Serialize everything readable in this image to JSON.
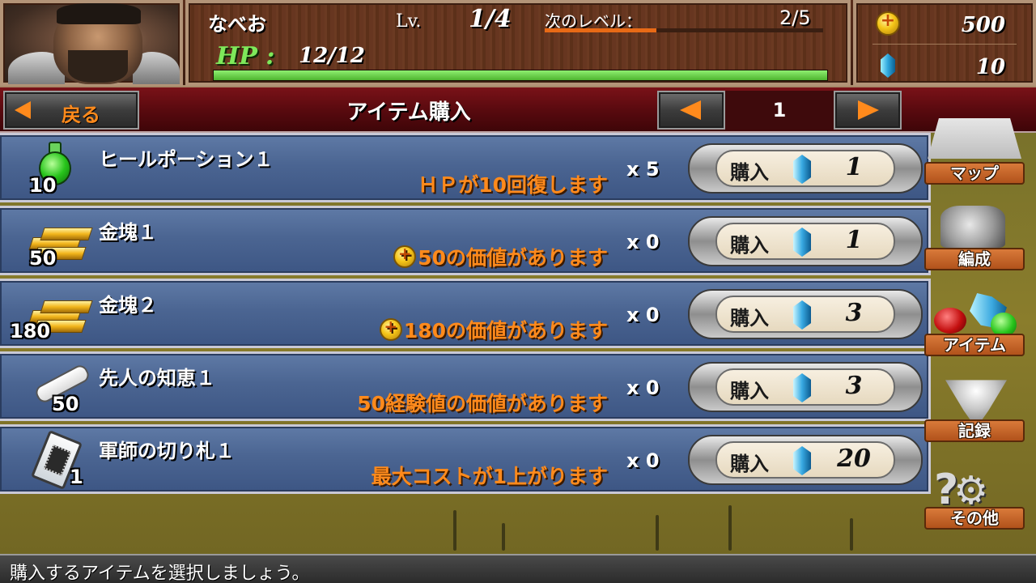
{
  "player": {
    "name": "なべお",
    "level_label": "Lv.",
    "level": "1/4",
    "next_level_label": "次のレベル：",
    "next_level_progress": "2/5",
    "next_level_fraction": 0.4,
    "hp_label": "HP :",
    "hp": "12/12",
    "hp_fraction": 1.0
  },
  "currency": {
    "gold": "500",
    "gems": "10"
  },
  "nav": {
    "back_label": "戻る",
    "title": "アイテム購入",
    "page": "1"
  },
  "buy_label": "購入",
  "items": [
    {
      "icon": "potion-icon",
      "count": "10",
      "name": "ヒールポーション１",
      "desc": "ＨＰが10回復します",
      "desc_coin": false,
      "qty": "x 5",
      "price": "1"
    },
    {
      "icon": "gold-bar-icon",
      "count": "50",
      "name": "金塊１",
      "desc": "50の価値があります",
      "desc_coin": true,
      "qty": "x 0",
      "price": "1"
    },
    {
      "icon": "gold-bar-icon",
      "count": "180",
      "name": "金塊２",
      "desc": "180の価値があります",
      "desc_coin": true,
      "qty": "x 0",
      "price": "3"
    },
    {
      "icon": "scroll-icon",
      "count": "50",
      "name": "先人の知恵１",
      "desc": "50経験値の価値があります",
      "desc_coin": false,
      "qty": "x 0",
      "price": "3"
    },
    {
      "icon": "card-icon",
      "count": "1",
      "name": "軍師の切り札１",
      "desc": "最大コストが1上がります",
      "desc_coin": false,
      "qty": "x 0",
      "price": "20"
    }
  ],
  "side_menu": {
    "map": "マップ",
    "formation": "編成",
    "items": "アイテム",
    "records": "記録",
    "other": "その他"
  },
  "footer": {
    "message": "購入するアイテムを選択しましょう。"
  },
  "colors": {
    "accent_orange": "#ff8a1c",
    "hp_green": "#7ee85a",
    "row_blue": "#4b6592",
    "nav_red": "#5a0a0f"
  }
}
